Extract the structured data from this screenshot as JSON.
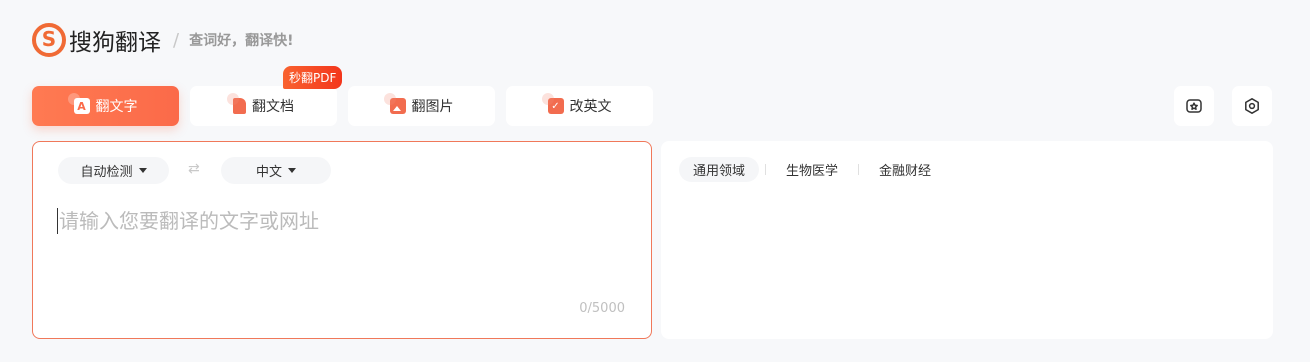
{
  "header": {
    "logo_mark": "S",
    "logo_text": "搜狗翻译",
    "separator": "/",
    "slogan": "查词好，翻译快!"
  },
  "badge": "秒翻PDF",
  "tabs": [
    {
      "label": "翻文字",
      "icon": "text-icon",
      "icon_glyph": "A",
      "active": true
    },
    {
      "label": "翻文档",
      "icon": "document-icon",
      "icon_glyph": "",
      "active": false
    },
    {
      "label": "翻图片",
      "icon": "image-icon",
      "icon_glyph": "",
      "active": false
    },
    {
      "label": "改英文",
      "icon": "edit-check-icon",
      "icon_glyph": "✓",
      "active": false
    }
  ],
  "toolbar": {
    "favorites_icon": "star-folder-icon",
    "settings_icon": "gear-icon"
  },
  "source": {
    "from_lang": "自动检测",
    "swap_glyph": "⇄",
    "to_lang": "中文",
    "placeholder": "请输入您要翻译的文字或网址",
    "counter": "0/5000"
  },
  "domains": [
    "通用领域",
    "生物医学",
    "金融财经"
  ],
  "colors": {
    "accent": "#fb6a49",
    "badge": "#f3361c",
    "background": "#f7f8fa"
  }
}
